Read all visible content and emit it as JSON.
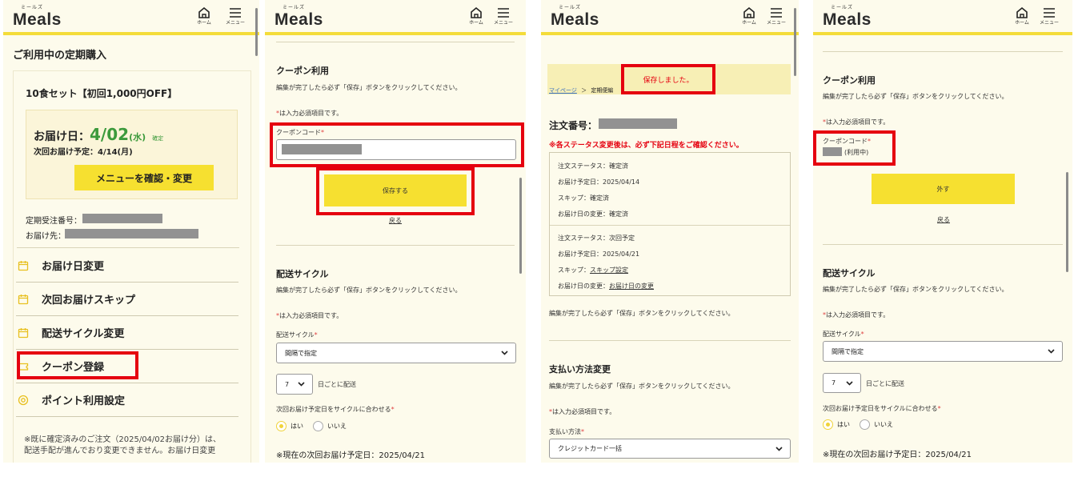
{
  "header": {
    "logo_kana": "ミールズ",
    "logo": "Meals",
    "home_label": "ホーム",
    "menu_label": "メニュー"
  },
  "colors": {
    "accent_yellow": "#f6e030",
    "highlight_red": "#e5000f",
    "panel_bg": "#fdfbec",
    "green": "#3c9a3c"
  },
  "panel1": {
    "page_title": "ご利用中の定期購入",
    "product_name": "10食セット【初回1,000円OFF】",
    "delivery_label": "お届け日：",
    "delivery_date": "4/02",
    "delivery_dow": "(水)",
    "confirmed_badge": "確定",
    "next_delivery": "次回お届け予定：4/14(月)",
    "menu_button": "メニューを確認・変更",
    "order_number_label": "定期受注番号：",
    "address_label": "お届け先：",
    "menu_items": [
      {
        "label": "お届け日変更",
        "icon": "calendar-icon"
      },
      {
        "label": "次回お届けスキップ",
        "icon": "calendar-icon"
      },
      {
        "label": "配送サイクル変更",
        "icon": "calendar-icon"
      },
      {
        "label": "クーポン登録",
        "icon": "ticket-icon"
      },
      {
        "label": "ポイント利用設定",
        "icon": "point-icon"
      }
    ],
    "footer_note_1": "※既に確定済みのご注文（2025/04/02お届け分）は、",
    "footer_note_2": "配送手配が進んでおり変更できません。お届け日変更"
  },
  "panel2": {
    "coupon_title": "クーポン利用",
    "edit_note": "編集が完了したら必ず「保存」ボタンをクリックしてください。",
    "required_note": "は入力必須項目です。",
    "required_mark": "*",
    "coupon_code_label": "クーポンコード",
    "save_button": "保存する",
    "back_link": "戻る",
    "cycle_title": "配送サイクル",
    "cycle_edit_note": "編集が完了したら必ず「保存」ボタンをクリックしてください。",
    "cycle_required_note": "は入力必須項目です。",
    "cycle_label": "配送サイクル",
    "cycle_value": "間隔で指定",
    "interval_value": "7",
    "interval_suffix": "日ごとに配送",
    "align_label": "次回お届け予定日をサイクルに合わせる",
    "yes_label": "はい",
    "no_label": "いいえ",
    "current_next": "※現在の次回お届け予定日：2025/04/21"
  },
  "panel3": {
    "saved_message": "保存しました。",
    "breadcrumb_mypage": "マイページ",
    "breadcrumb_sep": "＞",
    "breadcrumb_current": "定期便編",
    "order_number_label": "注文番号：",
    "warning": "※各ステータス変更後は、必ず下記日程をご確認ください。",
    "block1": [
      "注文ステータス：確定済",
      "お届け予定日：2025/04/14",
      "スキップ：確定済",
      "お届け日の変更：確定済"
    ],
    "block2_status": "注文ステータス：次回予定",
    "block2_date": "お届け予定日：2025/04/21",
    "block2_skip_label": "スキップ：",
    "block2_skip_link": "スキップ設定",
    "block2_change_label": "お届け日の変更：",
    "block2_change_link": "お届け日の変更",
    "edit_note": "編集が完了したら必ず「保存」ボタンをクリックしてください。",
    "payment_title": "支払い方法変更",
    "payment_edit_note": "編集が完了したら必ず「保存」ボタンをクリックしてください。",
    "payment_required_note": "は入力必須項目です。",
    "payment_label": "支払い方法",
    "payment_value": "クレジットカード一括"
  },
  "panel4": {
    "coupon_title": "クーポン利用",
    "edit_note": "編集が完了したら必ず「保存」ボタンをクリックしてください。",
    "required_note": "は入力必須項目です。",
    "coupon_code_label": "クーポンコード",
    "in_use": "(利用中)",
    "remove_button": "外す",
    "back_link": "戻る",
    "cycle_title": "配送サイクル",
    "cycle_edit_note": "編集が完了したら必ず「保存」ボタンをクリックしてください。",
    "cycle_required_note": "は入力必須項目です。",
    "cycle_label": "配送サイクル",
    "cycle_value": "間隔で指定",
    "interval_value": "7",
    "interval_suffix": "日ごとに配送",
    "align_label": "次回お届け予定日をサイクルに合わせる",
    "yes_label": "はい",
    "no_label": "いいえ",
    "current_next": "※現在の次回お届け予定日：2025/04/21"
  }
}
